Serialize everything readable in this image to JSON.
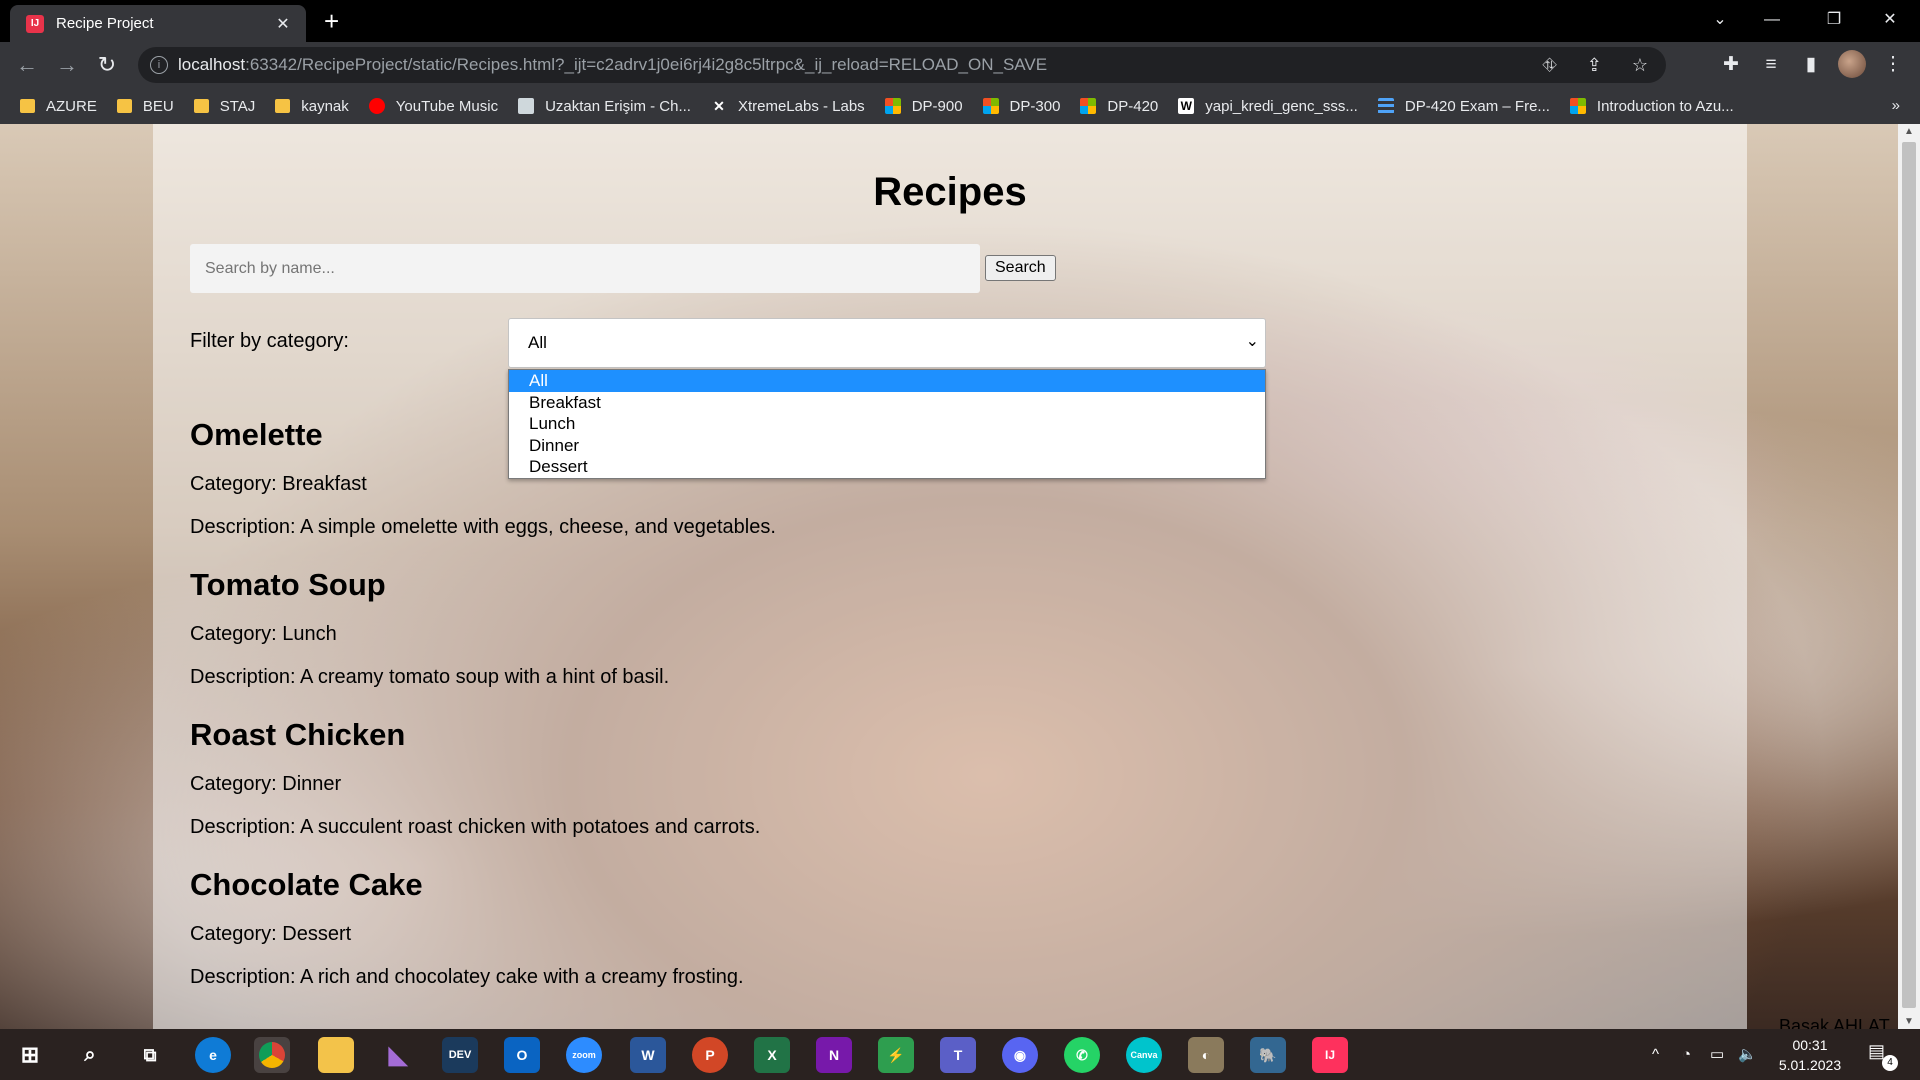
{
  "browser": {
    "tab_title": "Recipe Project",
    "tab_close": "✕",
    "new_tab": "+",
    "url_host": "localhost",
    "url_rest": ":63342/RecipeProject/static/Recipes.html?_ijt=c2adrv1j0ei6rj4i2g8c5ltrpc&_ij_reload=RELOAD_ON_SAVE",
    "bookmarks": [
      {
        "label": "AZURE",
        "icon": "folder-icon"
      },
      {
        "label": "BEU",
        "icon": "folder-icon"
      },
      {
        "label": "STAJ",
        "icon": "folder-icon"
      },
      {
        "label": "kaynak",
        "icon": "folder-icon"
      },
      {
        "label": "YouTube Music",
        "icon": "youtube-music-icon"
      },
      {
        "label": "Uzaktan Erişim - Ch...",
        "icon": "remote-desktop-icon"
      },
      {
        "label": "XtremeLabs - Labs",
        "icon": "xtremelabs-icon"
      },
      {
        "label": "DP-900",
        "icon": "microsoft-icon"
      },
      {
        "label": "DP-300",
        "icon": "microsoft-icon"
      },
      {
        "label": "DP-420",
        "icon": "microsoft-icon"
      },
      {
        "label": "yapi_kredi_genc_sss...",
        "icon": "word-doc-icon"
      },
      {
        "label": "DP-420 Exam – Fre...",
        "icon": "exam-icon"
      },
      {
        "label": "Introduction to Azu...",
        "icon": "microsoft-icon"
      }
    ],
    "bookmarks_more": "»"
  },
  "page": {
    "title": "Recipes",
    "search_placeholder": "Search by name...",
    "search_button": "Search",
    "filter_label": "Filter by category:",
    "selected_category": "All",
    "category_options": [
      "All",
      "Breakfast",
      "Lunch",
      "Dinner",
      "Dessert"
    ],
    "recipes": [
      {
        "name": "Omelette",
        "category": "Category: Breakfast",
        "description": "Description: A simple omelette with eggs, cheese, and vegetables."
      },
      {
        "name": "Tomato Soup",
        "category": "Category: Lunch",
        "description": "Description: A creamy tomato soup with a hint of basil."
      },
      {
        "name": "Roast Chicken",
        "category": "Category: Dinner",
        "description": "Description: A succulent roast chicken with potatoes and carrots."
      },
      {
        "name": "Chocolate Cake",
        "category": "Category: Dessert",
        "description": "Description: A rich and chocolatey cake with a creamy frosting."
      }
    ],
    "footer_name": "Basak AHLAT"
  },
  "taskbar": {
    "apps": [
      "start",
      "search",
      "task-view",
      "edge",
      "chrome",
      "file-explorer",
      "visual-studio",
      "dev",
      "outlook",
      "zoom",
      "word",
      "powerpoint",
      "excel",
      "onenote",
      "green-app",
      "teams",
      "discord",
      "whatsapp",
      "canva",
      "gimp",
      "pgadmin",
      "intellij"
    ],
    "time": "00:31",
    "date": "5.01.2023",
    "notification_count": "4"
  }
}
